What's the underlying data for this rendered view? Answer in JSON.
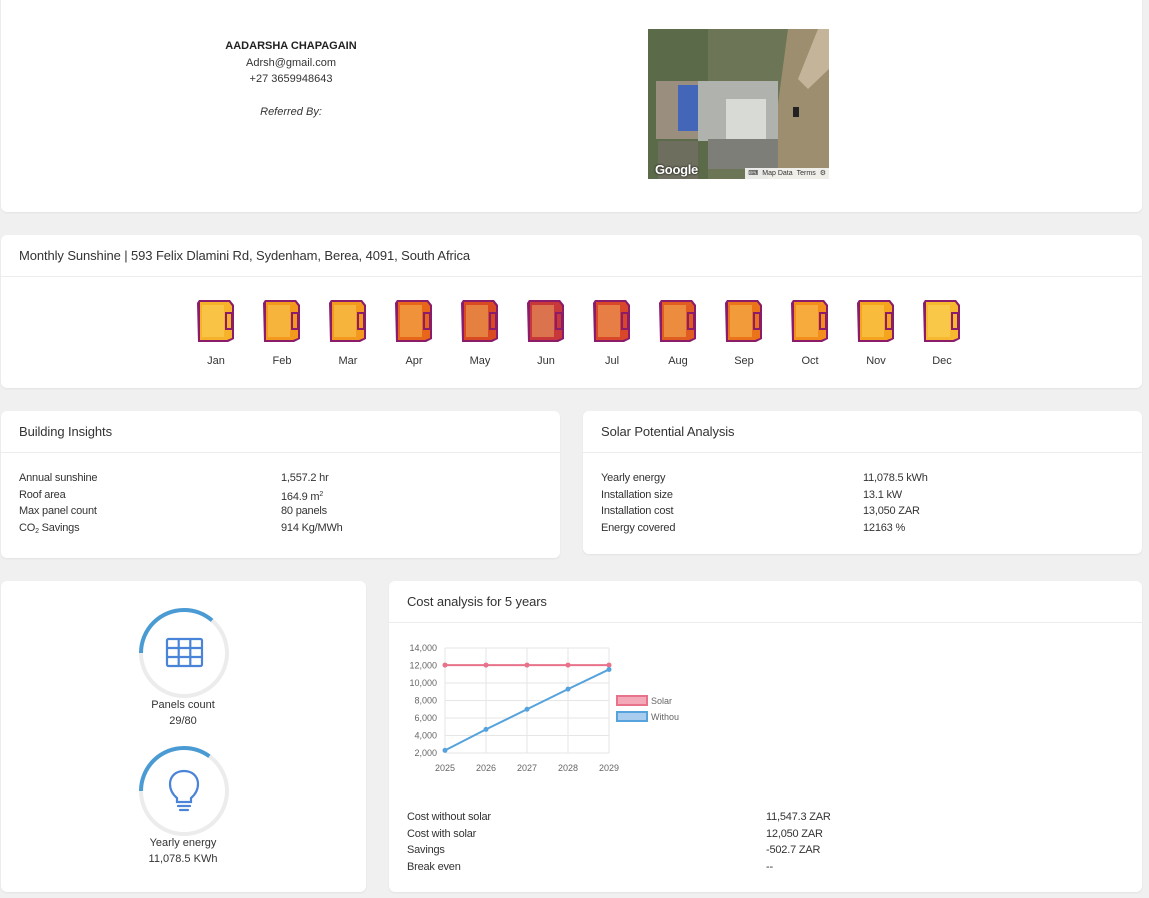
{
  "profile": {
    "name": "AADARSHA CHAPAGAIN",
    "email": "Adrsh@gmail.com",
    "phone": "+27 3659948643",
    "referred_by_label": "Referred By:",
    "map": {
      "logo": "Google",
      "keyboard_icon": "keyboard-icon",
      "map_data_label": "Map Data",
      "terms_label": "Terms"
    }
  },
  "sunshine": {
    "title": "Monthly Sunshine | 593 Felix Dlamini Rd, Sydenham, Berea, 4091, South Africa",
    "months": [
      {
        "label": "Jan",
        "color": "#f6b22a"
      },
      {
        "label": "Feb",
        "color": "#f39a1e"
      },
      {
        "label": "Mar",
        "color": "#f39a1e"
      },
      {
        "label": "Apr",
        "color": "#e8661a"
      },
      {
        "label": "May",
        "color": "#d94a22"
      },
      {
        "label": "Jun",
        "color": "#c8373a"
      },
      {
        "label": "Jul",
        "color": "#d9472b"
      },
      {
        "label": "Aug",
        "color": "#e15c20"
      },
      {
        "label": "Sep",
        "color": "#eb741a"
      },
      {
        "label": "Oct",
        "color": "#f38d1c"
      },
      {
        "label": "Nov",
        "color": "#f5a51d"
      },
      {
        "label": "Dec",
        "color": "#f6b830"
      }
    ]
  },
  "building_insights": {
    "title": "Building Insights",
    "rows": [
      {
        "label": "Annual sunshine",
        "value": "1,557.2 hr"
      },
      {
        "label": "Roof area",
        "value": "164.9 m",
        "sup": "2"
      },
      {
        "label": "Max panel count",
        "value": "80 panels"
      },
      {
        "label": "CO",
        "sub": "2",
        "label_suffix": " Savings",
        "value": "914 Kg/MWh"
      }
    ]
  },
  "solar_potential": {
    "title": "Solar Potential Analysis",
    "rows": [
      {
        "label": "Yearly energy",
        "value": "11,078.5 kWh"
      },
      {
        "label": "Installation size",
        "value": "13.1 kW"
      },
      {
        "label": "Installation cost",
        "value": "13,050 ZAR"
      },
      {
        "label": "Energy covered",
        "value": "12163 %"
      }
    ]
  },
  "gauges": {
    "panels": {
      "label": "Panels count",
      "value": "29/80",
      "fraction": 0.3625,
      "icon": "grid-icon"
    },
    "energy": {
      "label": "Yearly energy",
      "value": "11,078.5 KWh",
      "fraction": 0.35,
      "icon": "lightbulb-icon"
    }
  },
  "cost_analysis": {
    "title": "Cost analysis for 5 years",
    "rows": [
      {
        "label": "Cost without solar",
        "value": "11,547.3 ZAR"
      },
      {
        "label": "Cost with solar",
        "value": "12,050 ZAR"
      },
      {
        "label": "Savings",
        "value": "-502.7 ZAR"
      },
      {
        "label": "Break even",
        "value": "--"
      }
    ]
  },
  "chart_data": {
    "type": "line",
    "x": [
      "2025",
      "2026",
      "2027",
      "2028",
      "2029"
    ],
    "ylim": [
      2000,
      14000
    ],
    "yticks": [
      "2,000",
      "4,000",
      "6,000",
      "8,000",
      "10,000",
      "12,000",
      "14,000"
    ],
    "grid": true,
    "legend_position": "right",
    "series": [
      {
        "name": "Solar",
        "color": "#e8728a",
        "fill": "#f3a9b8",
        "values": [
          12050,
          12050,
          12050,
          12050,
          12050
        ]
      },
      {
        "name": "Withou",
        "color": "#55a2dc",
        "fill": "#a8cdee",
        "values": [
          2300,
          4700,
          7000,
          9300,
          11547.3
        ]
      }
    ]
  }
}
